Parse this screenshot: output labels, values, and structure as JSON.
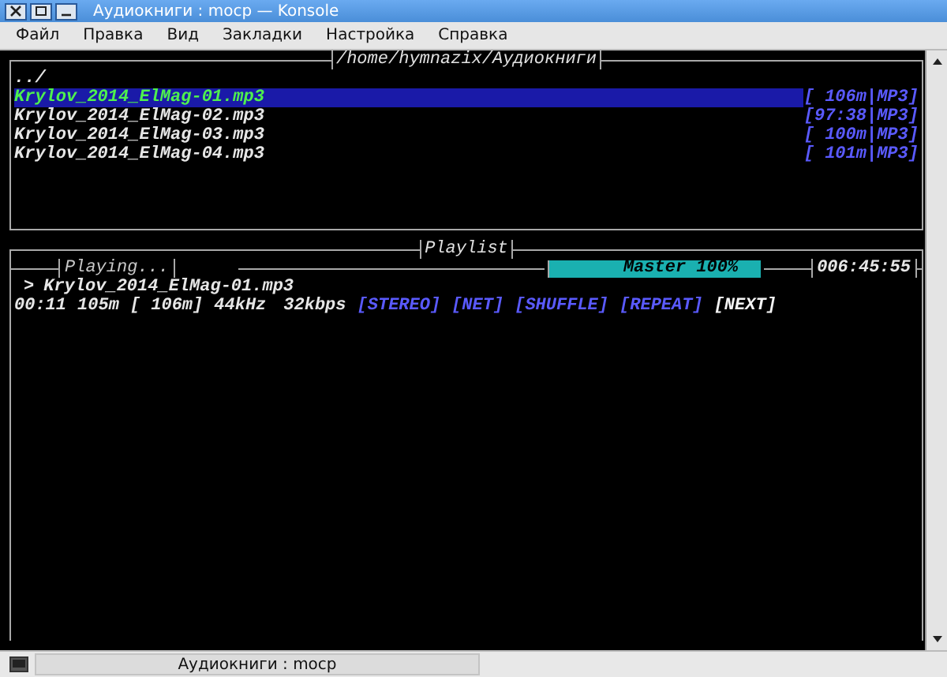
{
  "window": {
    "title": "Аудиокниги : mocp — Konsole"
  },
  "menu": [
    "Файл",
    "Правка",
    "Вид",
    "Закладки",
    "Настройка",
    "Справка"
  ],
  "browser": {
    "path": "/home/hymnazix/Аудиокниги",
    "parent": "../",
    "entries": [
      {
        "name": "Krylov_2014_ElMag-01.mp3",
        "info": "[ 106m|MP3]",
        "selected": true
      },
      {
        "name": "Krylov_2014_ElMag-02.mp3",
        "info": "[97:38|MP3]",
        "selected": false
      },
      {
        "name": "Krylov_2014_ElMag-03.mp3",
        "info": "[ 100m|MP3]",
        "selected": false
      },
      {
        "name": "Krylov_2014_ElMag-04.mp3",
        "info": "[ 101m|MP3]",
        "selected": false
      }
    ]
  },
  "playlist": {
    "title": "Playlist"
  },
  "status": {
    "state": "Playing...",
    "mixer": {
      "label": "Master 100%",
      "level": 1.0
    },
    "total_time": "006:45:55",
    "track_marker": ">",
    "track": "Krylov_2014_ElMag-01.mp3",
    "elapsed": "00:11",
    "left": "105m",
    "duration": "[ 106m]",
    "rate": "44kHz",
    "bitrate": "32kbps",
    "flags": [
      {
        "label": "[STEREO]",
        "on": false
      },
      {
        "label": "[NET]",
        "on": false
      },
      {
        "label": "[SHUFFLE]",
        "on": false
      },
      {
        "label": "[REPEAT]",
        "on": false
      },
      {
        "label": "[NEXT]",
        "on": true
      }
    ]
  },
  "taskbar": {
    "task": "Аудиокниги : mocp"
  }
}
